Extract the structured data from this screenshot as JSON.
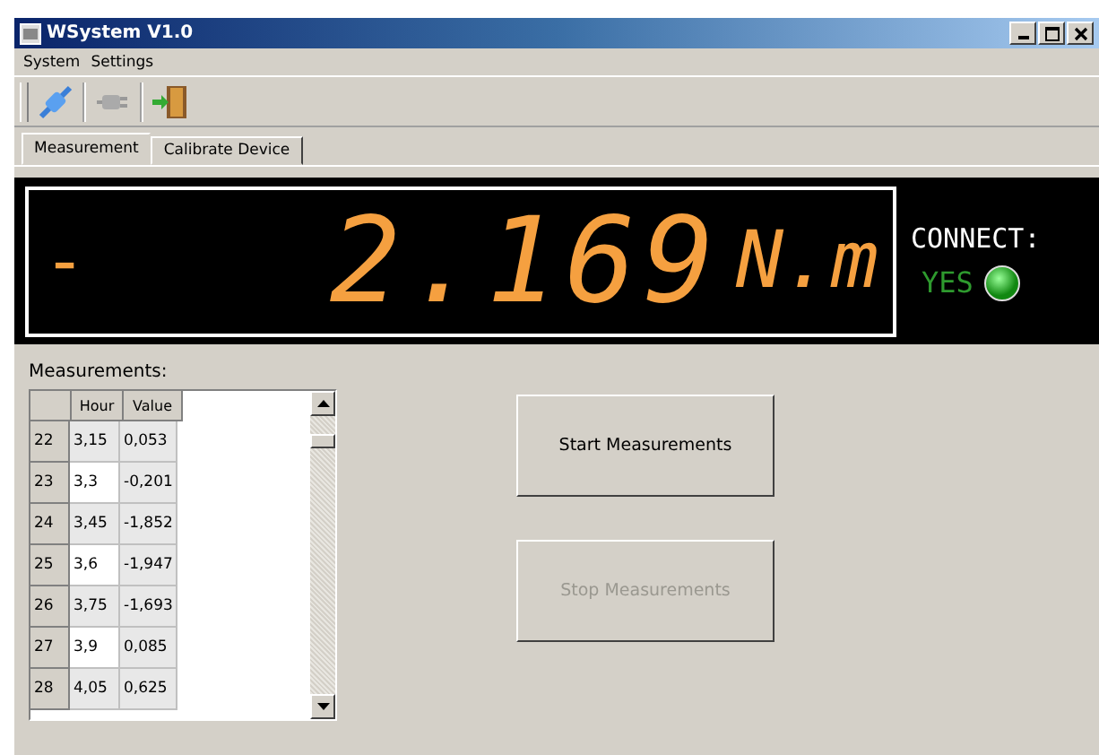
{
  "window": {
    "title": "WSystem V1.0"
  },
  "menu": [
    "System",
    "Settings"
  ],
  "tabs": [
    {
      "label": "Measurement",
      "selected": true
    },
    {
      "label": "Calibrate Device",
      "selected": false
    }
  ],
  "display": {
    "sign": "-",
    "value": "2.169",
    "unit": "N.m",
    "connect_label": "CONNECT:",
    "connect_value": "YES",
    "connected": true
  },
  "table": {
    "title": "Measurements:",
    "columns": [
      "Hour",
      "Value"
    ],
    "rows": [
      {
        "index": "22",
        "hour": "3,15",
        "value": "0,053"
      },
      {
        "index": "23",
        "hour": "3,3",
        "value": "-0,201"
      },
      {
        "index": "24",
        "hour": "3,45",
        "value": "-1,852"
      },
      {
        "index": "25",
        "hour": "3,6",
        "value": "-1,947"
      },
      {
        "index": "26",
        "hour": "3,75",
        "value": "-1,693"
      },
      {
        "index": "27",
        "hour": "3,9",
        "value": "0,085"
      },
      {
        "index": "28",
        "hour": "4,05",
        "value": "0,625"
      }
    ]
  },
  "buttons": [
    {
      "label": "Start Measurements",
      "disabled": false
    },
    {
      "label": "Stop Measurements",
      "disabled": true
    }
  ]
}
